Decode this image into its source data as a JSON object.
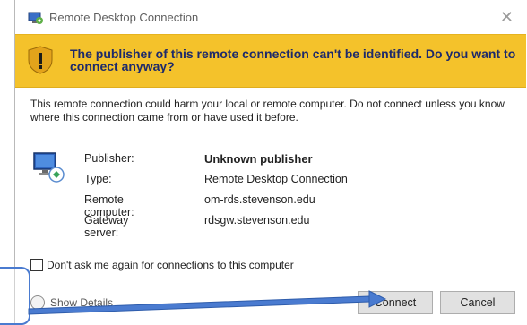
{
  "window": {
    "title": "Remote Desktop Connection",
    "close_symbol": "✕"
  },
  "banner": {
    "text": "The publisher of this remote connection can't be identified. Do you want to connect anyway?",
    "icon": "warning-shield-icon",
    "color": "#f4c22b"
  },
  "message": "This remote connection could harm your local or remote computer. Do not connect unless you know where this connection came from or have used it before.",
  "details": [
    {
      "label": "Publisher:",
      "value": "Unknown publisher"
    },
    {
      "label": "Type:",
      "value": "Remote Desktop Connection"
    },
    {
      "label": "Remote computer:",
      "value": "om-rds.stevenson.edu"
    },
    {
      "label": "Gateway server:",
      "value": "rdsgw.stevenson.edu"
    }
  ],
  "checkbox": {
    "label": "Don't ask me again for connections to this computer",
    "checked": false
  },
  "show_details": {
    "label": "Show Details"
  },
  "buttons": {
    "connect": "Connect",
    "cancel": "Cancel"
  },
  "annotation": {
    "arrow_color": "#4a7bd0"
  }
}
